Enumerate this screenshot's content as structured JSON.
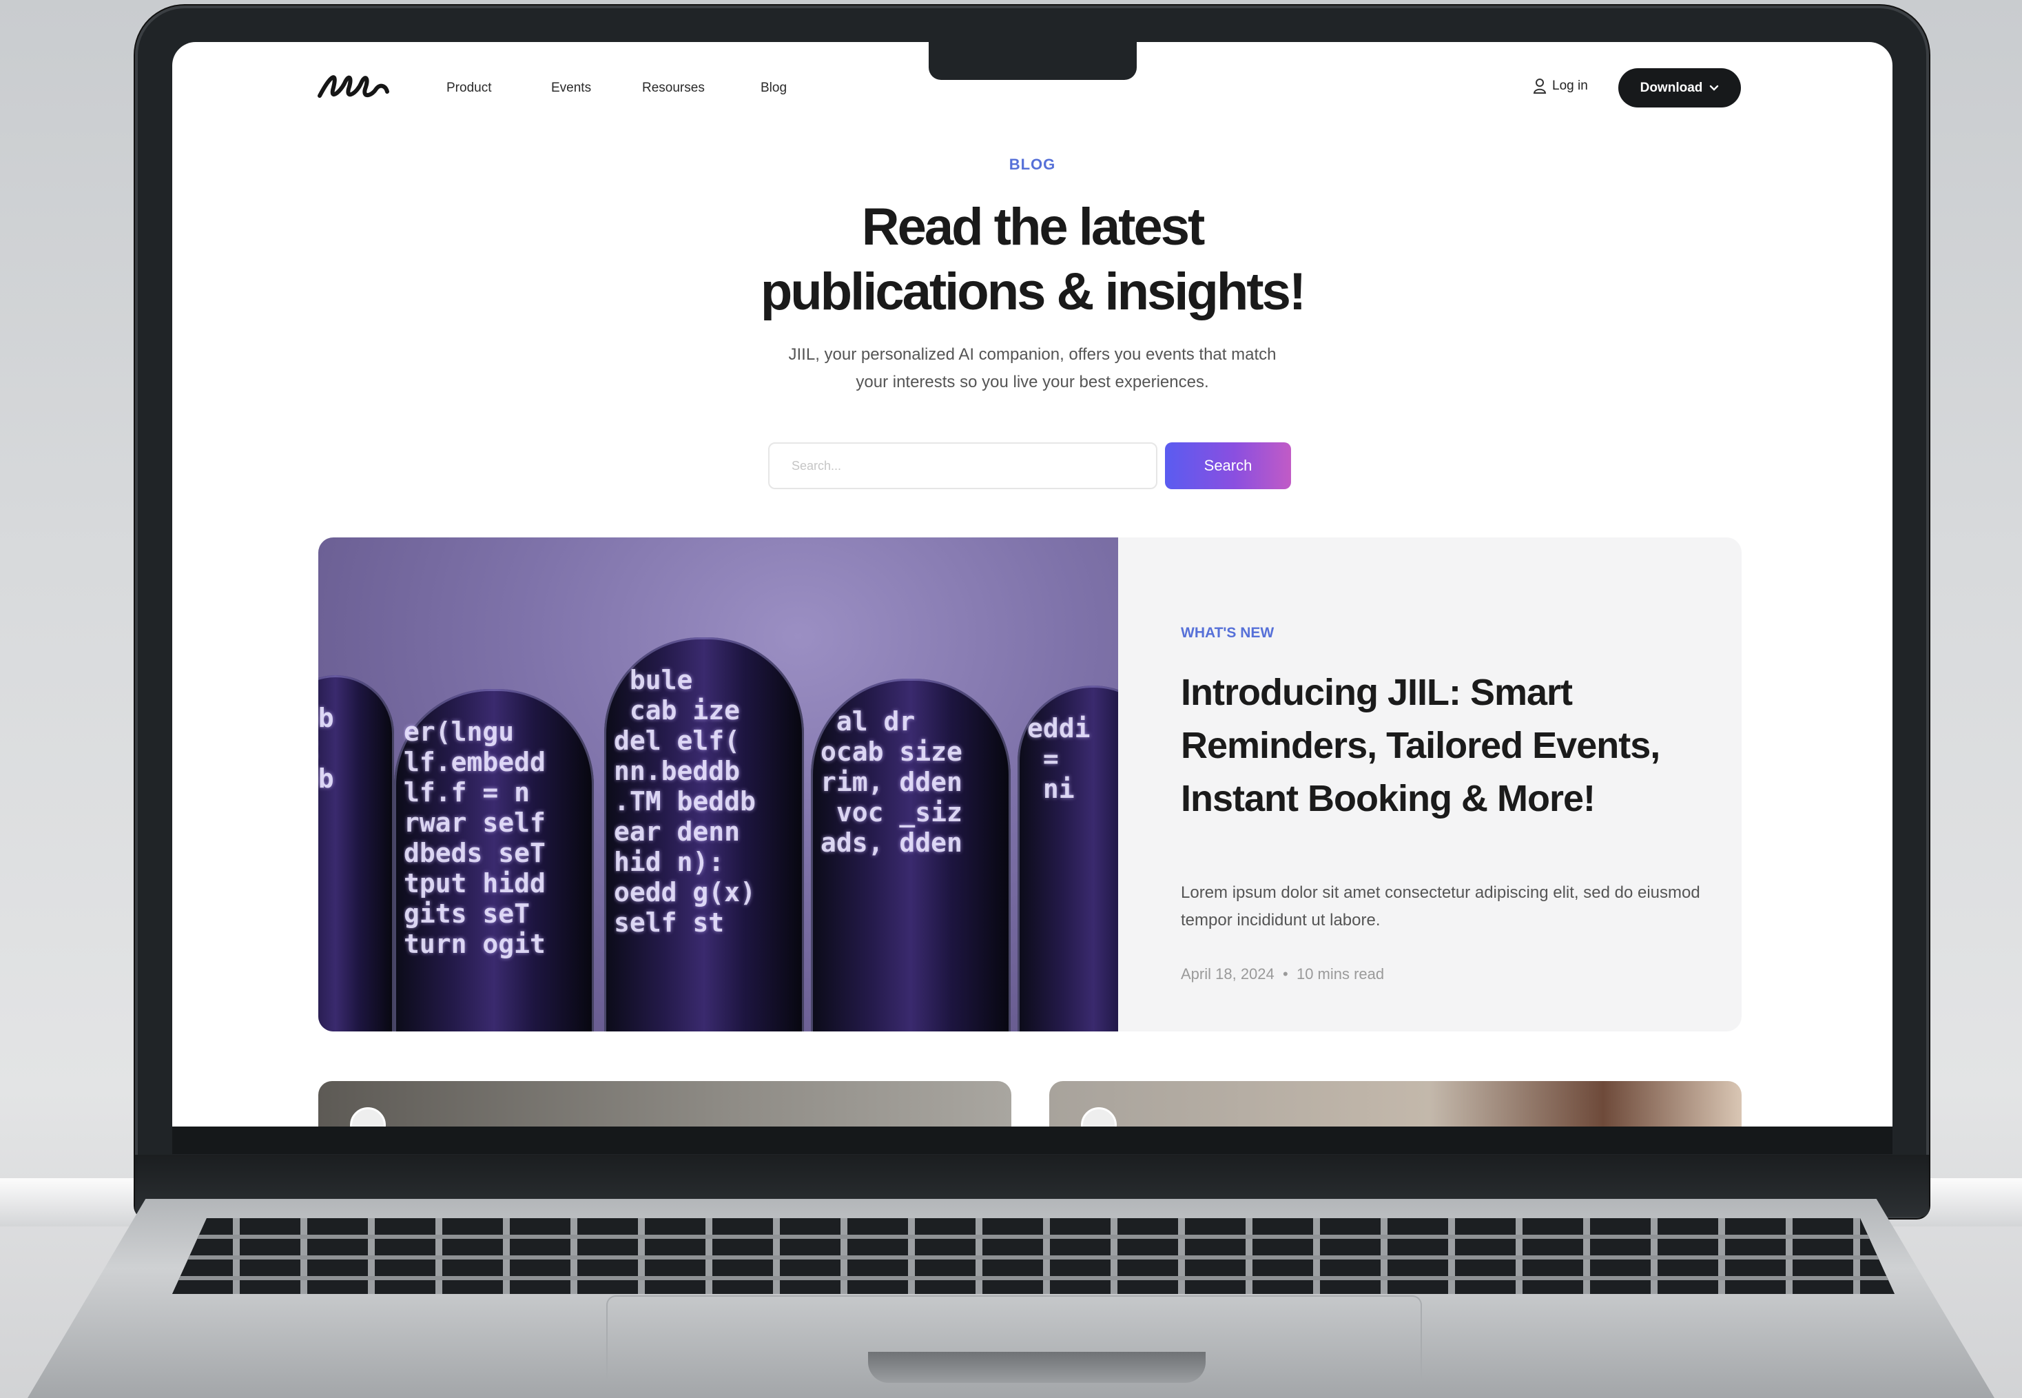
{
  "nav": {
    "logo_alt": "JIIL",
    "links": [
      "Product",
      "Events",
      "Resourses",
      "Blog"
    ],
    "login": "Log in",
    "download": "Download"
  },
  "hero": {
    "eyebrow": "BLOG",
    "headline_line1": "Read the latest",
    "headline_line2": "publications & insights!",
    "subtitle_line1": "JIIL, your personalized AI companion, offers you events that match",
    "subtitle_line2": "your interests so you live your best experiences."
  },
  "search": {
    "placeholder": "Search...",
    "button": "Search"
  },
  "featured": {
    "tag": "WHAT'S NEW",
    "title": "Introducing JIIL: Smart Reminders, Tailored Events, Instant Booking & More!",
    "excerpt": "Lorem ipsum dolor sit amet consectetur adipiscing elit, sed do eiusmod tempor incididunt ut labore.",
    "date": "April 18, 2024",
    "read_time": "10 mins read"
  },
  "icons": {
    "user": "user-icon",
    "chevron": "chevron-down-icon"
  },
  "colors": {
    "accent": "#5670d8",
    "button_dark": "#17191b",
    "gradient_start": "#5a5cf0",
    "gradient_end": "#c15bc6"
  }
}
